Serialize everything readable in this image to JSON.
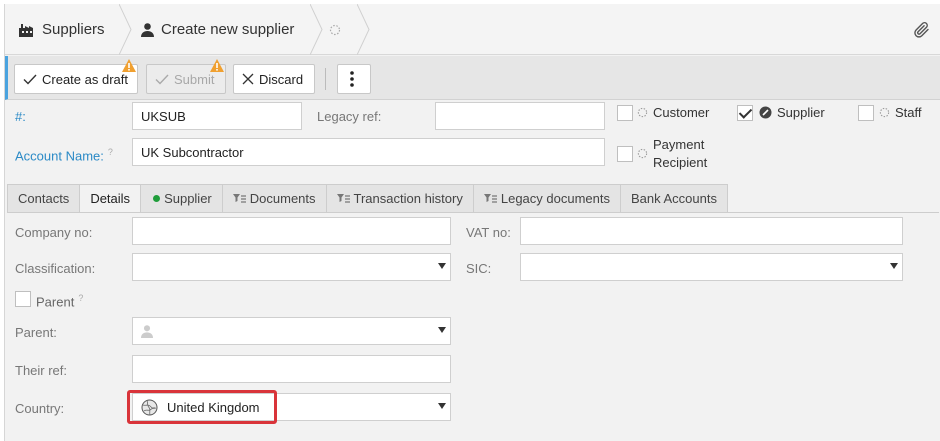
{
  "breadcrumb": {
    "items": [
      {
        "label": "Suppliers",
        "icon": "factory-icon"
      },
      {
        "label": "Create new supplier",
        "icon": "person-icon"
      },
      {
        "label": "",
        "icon": "loading-spinner-icon"
      }
    ],
    "attach_icon": "paperclip-icon"
  },
  "toolbar": {
    "create_draft_label": "Create as draft",
    "submit_label": "Submit",
    "discard_label": "Discard",
    "warning_color": "#f0a030"
  },
  "header": {
    "number_label": "#:",
    "number_value": "UKSUB",
    "legacy_ref_label": "Legacy ref:",
    "legacy_ref_value": "",
    "account_name_label": "Account Name:",
    "account_name_hint": "?",
    "account_name_value": "UK Subcontractor",
    "roles": [
      {
        "label": "Customer",
        "checked": false
      },
      {
        "label": "Supplier",
        "checked": true
      },
      {
        "label": "Staff",
        "checked": false
      },
      {
        "label_line1": "Payment",
        "label_line2": "Recipient",
        "checked": false
      }
    ]
  },
  "tabs": [
    {
      "label": "Contacts",
      "active": false
    },
    {
      "label": "Details",
      "active": true
    },
    {
      "label": "Supplier",
      "active": false,
      "status_color": "#1f9d3a"
    },
    {
      "label": "Documents",
      "active": false
    },
    {
      "label": "Transaction history",
      "active": false
    },
    {
      "label": "Legacy documents",
      "active": false
    },
    {
      "label": "Bank Accounts",
      "active": false
    }
  ],
  "details": {
    "company_no_label": "Company no:",
    "company_no_value": "",
    "vat_no_label": "VAT no:",
    "vat_no_value": "",
    "classification_label": "Classification:",
    "classification_value": "",
    "sic_label": "SIC:",
    "sic_value": "",
    "parent_checkbox_label": "Parent",
    "parent_hint": "?",
    "parent_label": "Parent:",
    "parent_value": "",
    "their_ref_label": "Their ref:",
    "their_ref_value": "",
    "country_label": "Country:",
    "country_value": "United Kingdom"
  },
  "colors": {
    "accent_blue": "#2b8ac6",
    "highlight_red": "#d9343a"
  }
}
